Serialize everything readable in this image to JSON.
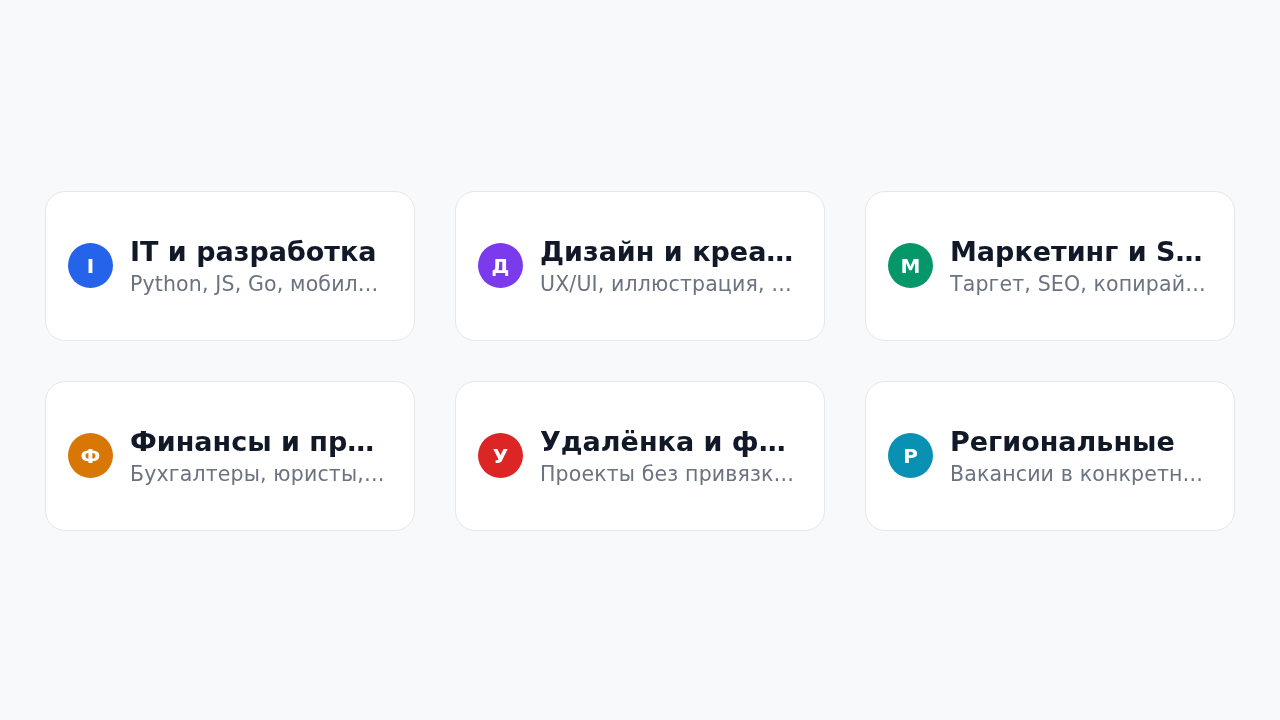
{
  "categories": [
    {
      "letter": "I",
      "title": "IT и разработка",
      "description": "Python, JS, Go, мобил…",
      "color": "#2563eb"
    },
    {
      "letter": "Д",
      "title": "Дизайн и креа…",
      "description": "UX/UI, иллюстрация, …",
      "color": "#7c3aed"
    },
    {
      "letter": "М",
      "title": "Маркетинг и S…",
      "description": "Таргет, SEO, копирай…",
      "color": "#059669"
    },
    {
      "letter": "Ф",
      "title": "Финансы и пр…",
      "description": "Бухгалтеры, юристы,…",
      "color": "#d97706"
    },
    {
      "letter": "У",
      "title": "Удалёнка и ф…",
      "description": "Проекты без привязк…",
      "color": "#dc2626"
    },
    {
      "letter": "Р",
      "title": "Региональные",
      "description": "Вакансии в конкретн…",
      "color": "#0891b2"
    }
  ]
}
